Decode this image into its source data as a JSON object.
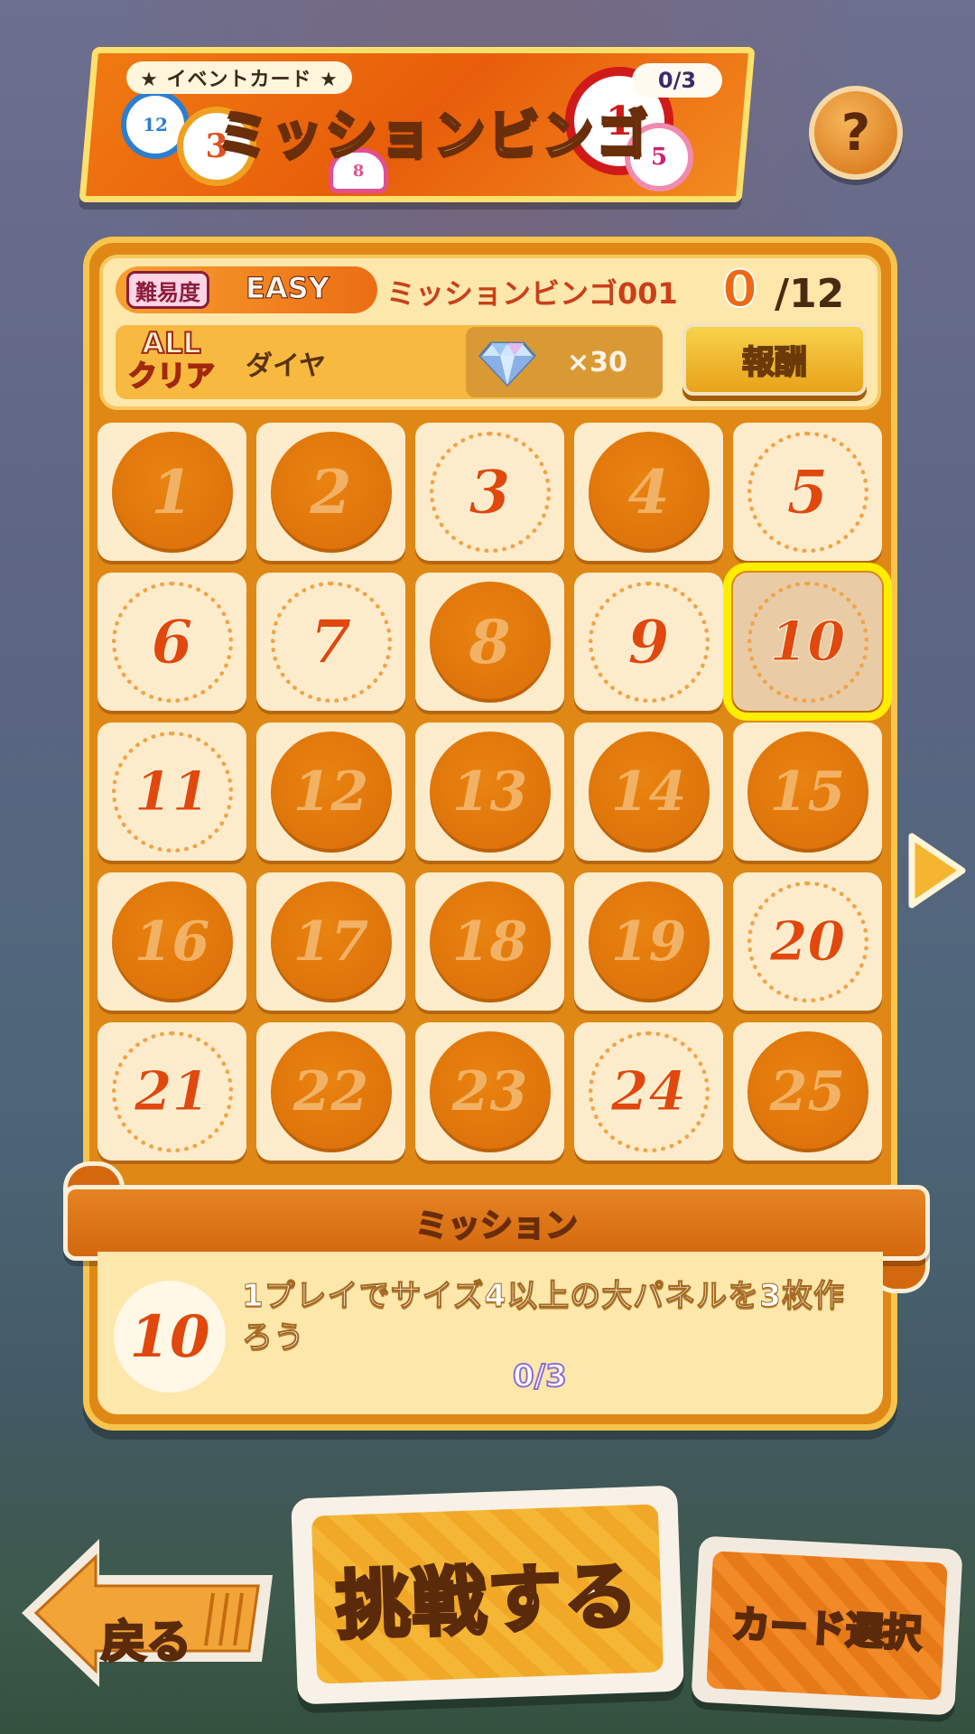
{
  "header": {
    "tag": "★ イベントカード ★",
    "title": "ミッションビンゴ",
    "count": "0/3",
    "balls": [
      "12",
      "3",
      "1",
      "5",
      "8"
    ],
    "help_label": "?"
  },
  "board": {
    "difficulty_label": "難易度",
    "difficulty": "EASY",
    "mission_set": "ミッションビンゴ001",
    "progress_current": "0",
    "progress_total": "/12",
    "all_clear_label": "ALL\nクリア",
    "reward_item": "ダイヤ",
    "reward_qty": "×30",
    "reward_button": "報酬"
  },
  "grid": [
    {
      "n": "1",
      "state": "done"
    },
    {
      "n": "2",
      "state": "done"
    },
    {
      "n": "3",
      "state": "open"
    },
    {
      "n": "4",
      "state": "done"
    },
    {
      "n": "5",
      "state": "open"
    },
    {
      "n": "6",
      "state": "open"
    },
    {
      "n": "7",
      "state": "open"
    },
    {
      "n": "8",
      "state": "done"
    },
    {
      "n": "9",
      "state": "open"
    },
    {
      "n": "10",
      "state": "selected"
    },
    {
      "n": "11",
      "state": "open"
    },
    {
      "n": "12",
      "state": "done"
    },
    {
      "n": "13",
      "state": "done"
    },
    {
      "n": "14",
      "state": "done"
    },
    {
      "n": "15",
      "state": "done"
    },
    {
      "n": "16",
      "state": "done"
    },
    {
      "n": "17",
      "state": "done"
    },
    {
      "n": "18",
      "state": "done"
    },
    {
      "n": "19",
      "state": "done"
    },
    {
      "n": "20",
      "state": "open"
    },
    {
      "n": "21",
      "state": "open"
    },
    {
      "n": "22",
      "state": "done"
    },
    {
      "n": "23",
      "state": "done"
    },
    {
      "n": "24",
      "state": "open"
    },
    {
      "n": "25",
      "state": "done"
    }
  ],
  "mission": {
    "ribbon_label": "ミッション",
    "number": "10",
    "text": "1プレイでサイズ4以上の大パネルを3枚作ろう",
    "progress": "0/3"
  },
  "buttons": {
    "back": "戻る",
    "challenge": "挑戦する",
    "card_select": "カード選択"
  },
  "colors": {
    "board": "#e08815",
    "highlight": "#ffee00",
    "accent_red": "#e0480e"
  }
}
